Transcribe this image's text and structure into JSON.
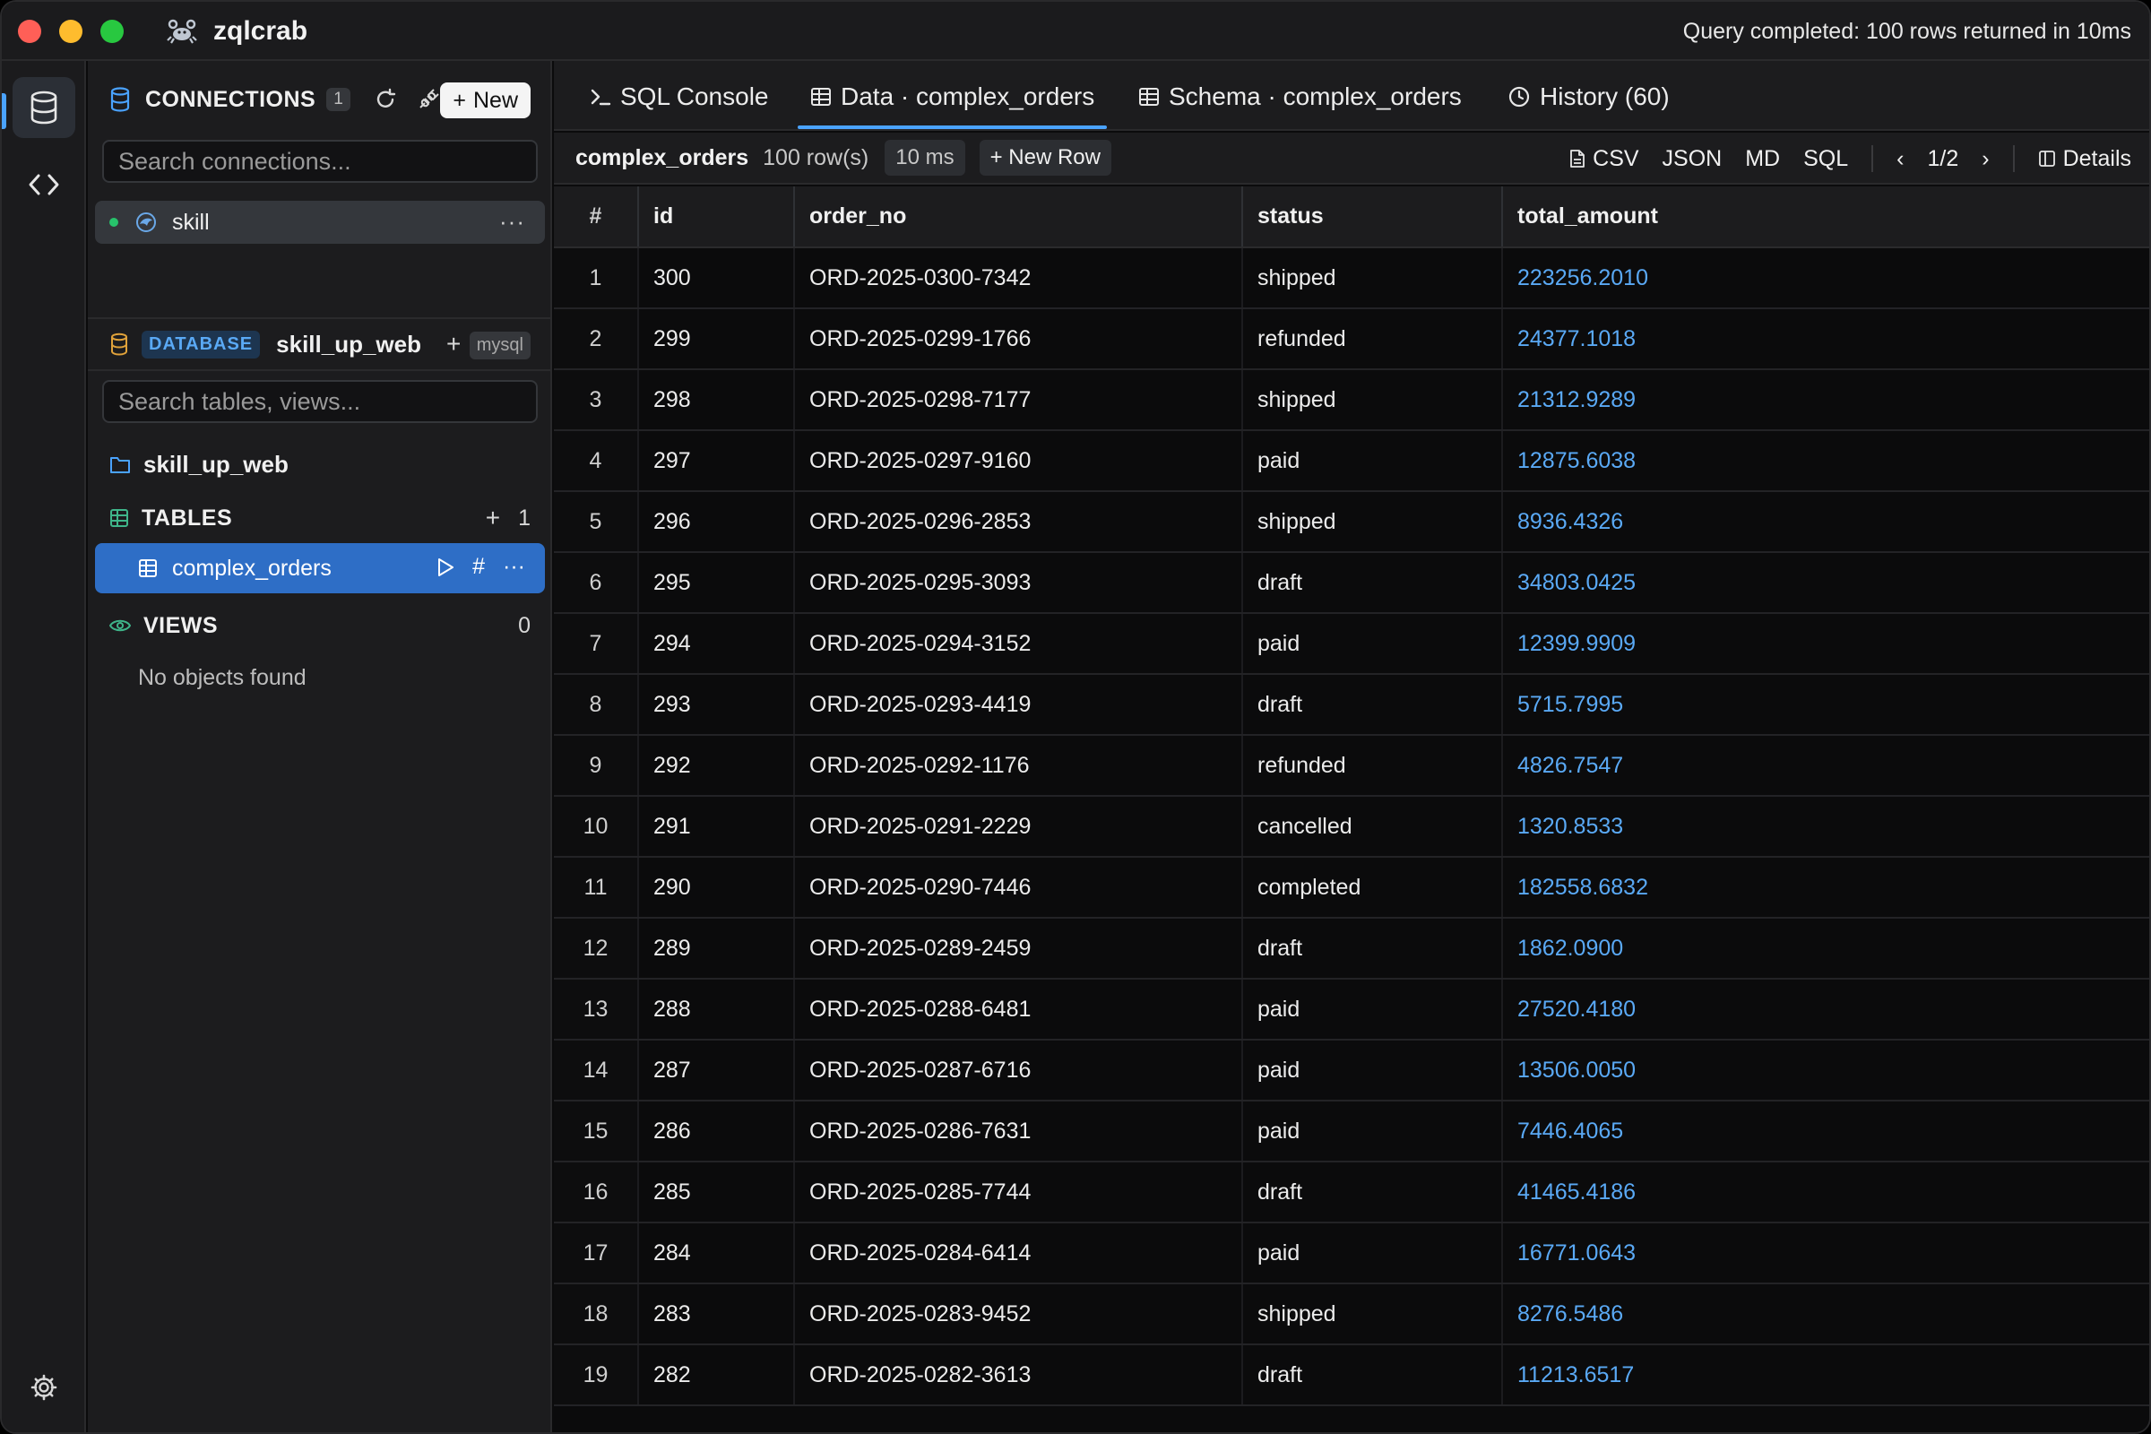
{
  "app": {
    "name": "zqlcrab",
    "status": "Query completed: 100 rows returned in 10ms"
  },
  "connections": {
    "title": "CONNECTIONS",
    "count": "1",
    "new_label": "New",
    "search_placeholder": "Search connections...",
    "items": [
      {
        "name": "skill",
        "status_color": "#27c26b"
      }
    ]
  },
  "database": {
    "tag": "DATABASE",
    "name": "skill_up_web",
    "engine": "mysql",
    "search_placeholder": "Search tables, views...",
    "schema_name": "skill_up_web",
    "tables_title": "TABLES",
    "tables_count": "1",
    "tables": [
      {
        "name": "complex_orders"
      }
    ],
    "views_title": "VIEWS",
    "views_count": "0",
    "empty_text": "No objects found"
  },
  "tabs": [
    {
      "label": "SQL Console",
      "icon": "terminal-icon"
    },
    {
      "label": "Data · complex_orders",
      "icon": "table-icon",
      "active": true
    },
    {
      "label": "Schema · complex_orders",
      "icon": "table-icon"
    },
    {
      "label": "History (60)",
      "icon": "clock-icon"
    }
  ],
  "toolbar": {
    "table": "complex_orders",
    "rows": "100 row(s)",
    "time": "10 ms",
    "new_row": "New Row",
    "csv": "CSV",
    "json": "JSON",
    "md": "MD",
    "sql": "SQL",
    "page": "1/2",
    "details": "Details"
  },
  "grid": {
    "columns": [
      "#",
      "id",
      "order_no",
      "status",
      "total_amount"
    ],
    "rows": [
      [
        "1",
        "300",
        "ORD-2025-0300-7342",
        "shipped",
        "223256.2010"
      ],
      [
        "2",
        "299",
        "ORD-2025-0299-1766",
        "refunded",
        "24377.1018"
      ],
      [
        "3",
        "298",
        "ORD-2025-0298-7177",
        "shipped",
        "21312.9289"
      ],
      [
        "4",
        "297",
        "ORD-2025-0297-9160",
        "paid",
        "12875.6038"
      ],
      [
        "5",
        "296",
        "ORD-2025-0296-2853",
        "shipped",
        "8936.4326"
      ],
      [
        "6",
        "295",
        "ORD-2025-0295-3093",
        "draft",
        "34803.0425"
      ],
      [
        "7",
        "294",
        "ORD-2025-0294-3152",
        "paid",
        "12399.9909"
      ],
      [
        "8",
        "293",
        "ORD-2025-0293-4419",
        "draft",
        "5715.7995"
      ],
      [
        "9",
        "292",
        "ORD-2025-0292-1176",
        "refunded",
        "4826.7547"
      ],
      [
        "10",
        "291",
        "ORD-2025-0291-2229",
        "cancelled",
        "1320.8533"
      ],
      [
        "11",
        "290",
        "ORD-2025-0290-7446",
        "completed",
        "182558.6832"
      ],
      [
        "12",
        "289",
        "ORD-2025-0289-2459",
        "draft",
        "1862.0900"
      ],
      [
        "13",
        "288",
        "ORD-2025-0288-6481",
        "paid",
        "27520.4180"
      ],
      [
        "14",
        "287",
        "ORD-2025-0287-6716",
        "paid",
        "13506.0050"
      ],
      [
        "15",
        "286",
        "ORD-2025-0286-7631",
        "paid",
        "7446.4065"
      ],
      [
        "16",
        "285",
        "ORD-2025-0285-7744",
        "draft",
        "41465.4186"
      ],
      [
        "17",
        "284",
        "ORD-2025-0284-6414",
        "paid",
        "16771.0643"
      ],
      [
        "18",
        "283",
        "ORD-2025-0283-9452",
        "shipped",
        "8276.5486"
      ],
      [
        "19",
        "282",
        "ORD-2025-0282-3613",
        "draft",
        "11213.6517"
      ]
    ]
  },
  "colors": {
    "accent": "#4aa3ff",
    "selected": "#2e6ec6",
    "amount": "#5aa9f5"
  }
}
